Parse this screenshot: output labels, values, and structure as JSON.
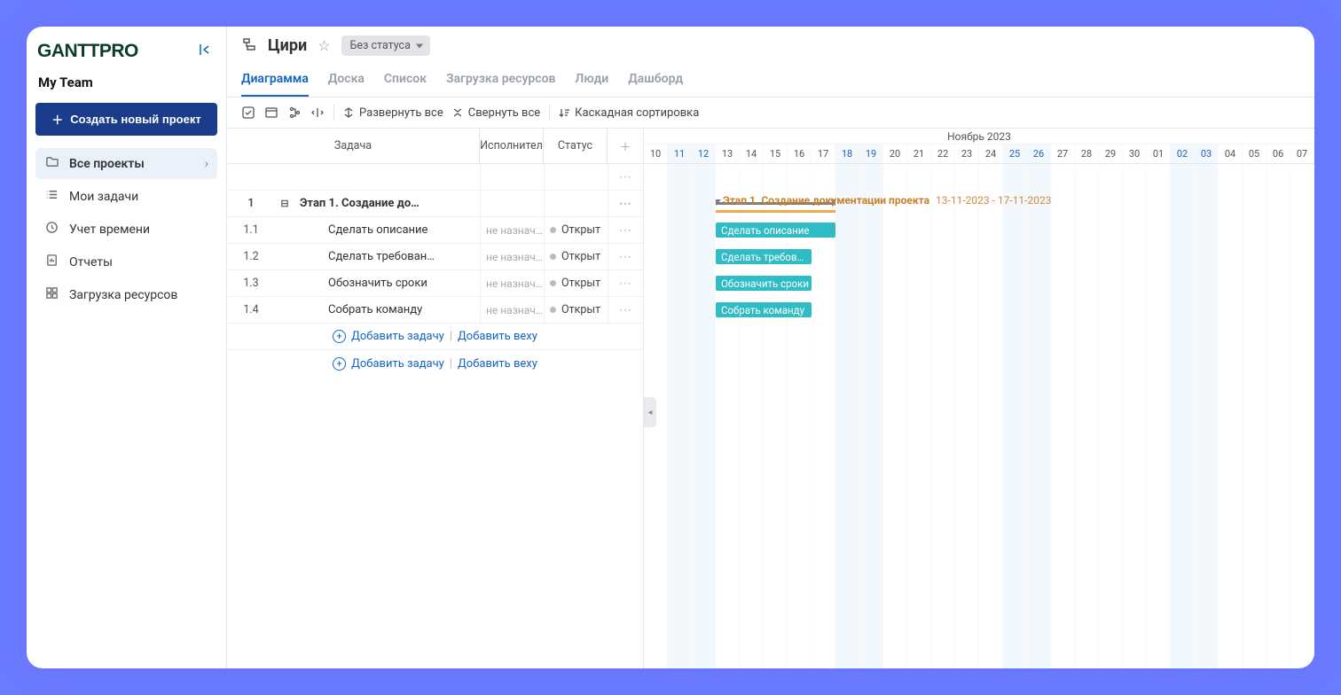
{
  "sidebar": {
    "logo": "GANTTPRO",
    "team": "My Team",
    "new_project": "Создать новый проект",
    "items": [
      {
        "label": "Все проекты",
        "icon": "folder",
        "active": true,
        "chev": true
      },
      {
        "label": "Мои задачи",
        "icon": "list"
      },
      {
        "label": "Учет времени",
        "icon": "clock"
      },
      {
        "label": "Отчеты",
        "icon": "report"
      },
      {
        "label": "Загрузка ресурсов",
        "icon": "grid"
      }
    ]
  },
  "header": {
    "project_title": "Цири",
    "status": "Без статуса"
  },
  "tabs": [
    "Диаграмма",
    "Доска",
    "Список",
    "Загрузка ресурсов",
    "Люди",
    "Дашборд"
  ],
  "active_tab": 0,
  "toolbar": {
    "expand_all": "Развернуть все",
    "collapse_all": "Свернуть все",
    "cascade_sort": "Каскадная сортировка"
  },
  "grid_headers": {
    "task": "Задача",
    "assignee": "Исполнител",
    "status": "Статус"
  },
  "timeline": {
    "month": "Ноябрь 2023",
    "days": [
      {
        "n": "10"
      },
      {
        "n": "11",
        "w": true
      },
      {
        "n": "12",
        "w": true
      },
      {
        "n": "13"
      },
      {
        "n": "14"
      },
      {
        "n": "15"
      },
      {
        "n": "16"
      },
      {
        "n": "17"
      },
      {
        "n": "18",
        "w": true
      },
      {
        "n": "19",
        "w": true
      },
      {
        "n": "20"
      },
      {
        "n": "21"
      },
      {
        "n": "22"
      },
      {
        "n": "23"
      },
      {
        "n": "24"
      },
      {
        "n": "25",
        "w": true
      },
      {
        "n": "26",
        "w": true
      },
      {
        "n": "27"
      },
      {
        "n": "28"
      },
      {
        "n": "29"
      },
      {
        "n": "30"
      },
      {
        "n": "01"
      },
      {
        "n": "02",
        "w": true
      },
      {
        "n": "03",
        "w": true
      },
      {
        "n": "04"
      },
      {
        "n": "05"
      },
      {
        "n": "06"
      },
      {
        "n": "07"
      }
    ]
  },
  "rows": [
    {
      "type": "blank"
    },
    {
      "type": "phase",
      "num": "1",
      "name": "Этап 1. Создание документации проекта",
      "short": "Этап 1. Создание до…",
      "dates": "13-11-2023 - 17-11-2023",
      "start": 3,
      "len": 5
    },
    {
      "type": "task",
      "num": "1.1",
      "name": "Сделать описание",
      "assignee": "не назнач…",
      "status": "Открыт",
      "start": 3,
      "len": 5
    },
    {
      "type": "task",
      "num": "1.2",
      "name": "Сделать требован…",
      "bar": "Сделать требов…",
      "assignee": "не назнач…",
      "status": "Открыт",
      "start": 3,
      "len": 4
    },
    {
      "type": "task",
      "num": "1.3",
      "name": "Обозначить сроки",
      "assignee": "не назнач…",
      "status": "Открыт",
      "start": 3,
      "len": 4
    },
    {
      "type": "task",
      "num": "1.4",
      "name": "Собрать команду",
      "assignee": "не назнач…",
      "status": "Открыт",
      "start": 3,
      "len": 4
    }
  ],
  "add": {
    "task": "Добавить задачу",
    "milestone": "Добавить веху"
  }
}
